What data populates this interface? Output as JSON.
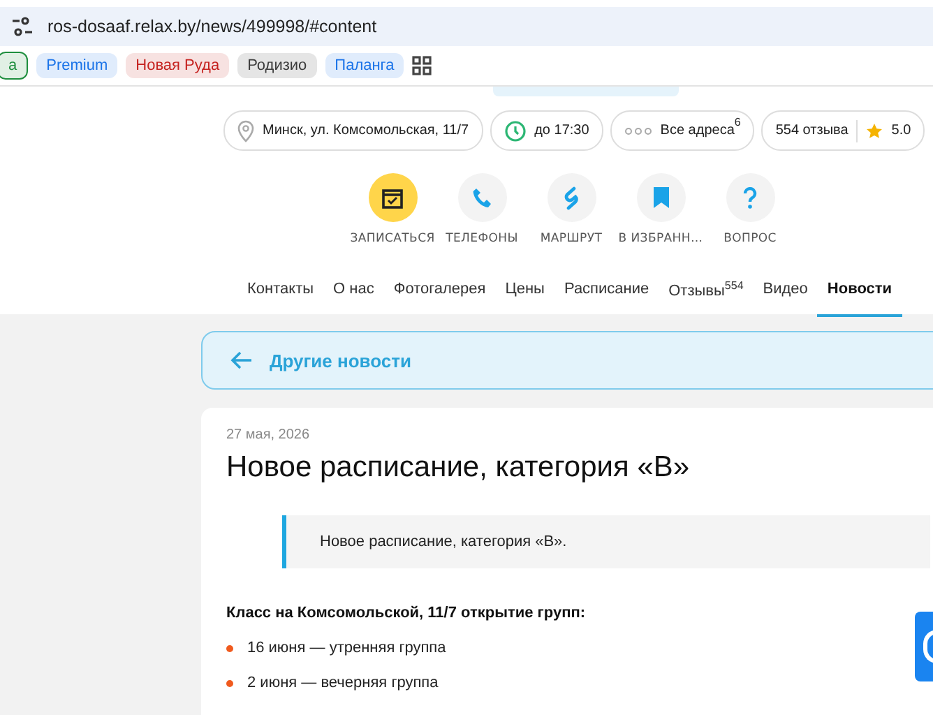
{
  "address_bar": {
    "url": "ros-dosaaf.relax.by/news/499998/#content"
  },
  "bookmarks": [
    {
      "label": "а",
      "color": "#1e8e3e"
    },
    {
      "label": "Premium",
      "color": "#1a73e8"
    },
    {
      "label": "Новая Руда",
      "color": "#c5221f"
    },
    {
      "label": "Родизио",
      "color": "#3c3c3c"
    },
    {
      "label": "Паланга",
      "color": "#1a73e8"
    }
  ],
  "info_pills": {
    "address": "Минск, ул. Комсомольская, 11/7",
    "hours": "до 17:30",
    "all_addresses": "Все адреса",
    "addresses_count": "6",
    "reviews": "554 отзыва",
    "rating": "5.0"
  },
  "actions": [
    {
      "label": "ЗАПИСАТЬСЯ",
      "primary": true
    },
    {
      "label": "ТЕЛЕФОНЫ",
      "primary": false
    },
    {
      "label": "МАРШРУТ",
      "primary": false
    },
    {
      "label": "В ИЗБРАНН…",
      "primary": false
    },
    {
      "label": "ВОПРОС",
      "primary": false
    }
  ],
  "nav_tabs": [
    {
      "label": "Контакты",
      "selected": false
    },
    {
      "label": "О нас",
      "selected": false
    },
    {
      "label": "Фотогалерея",
      "selected": false
    },
    {
      "label": "Цены",
      "selected": false
    },
    {
      "label": "Расписание",
      "selected": false
    },
    {
      "label": "Отзывы",
      "count": "554",
      "selected": false
    },
    {
      "label": "Видео",
      "selected": false
    },
    {
      "label": "Новости",
      "selected": true
    }
  ],
  "back_link": "Другие новости",
  "article": {
    "date": "27 мая, 2026",
    "title": "Новое расписание, категория «В»",
    "quote": "Новое расписание, категория «В».",
    "subheading": "Класс на Комсомольской, 11/7 открытие групп:",
    "list": [
      "16 июня — утренняя группа",
      "2 июня — вечерняя группа"
    ]
  }
}
